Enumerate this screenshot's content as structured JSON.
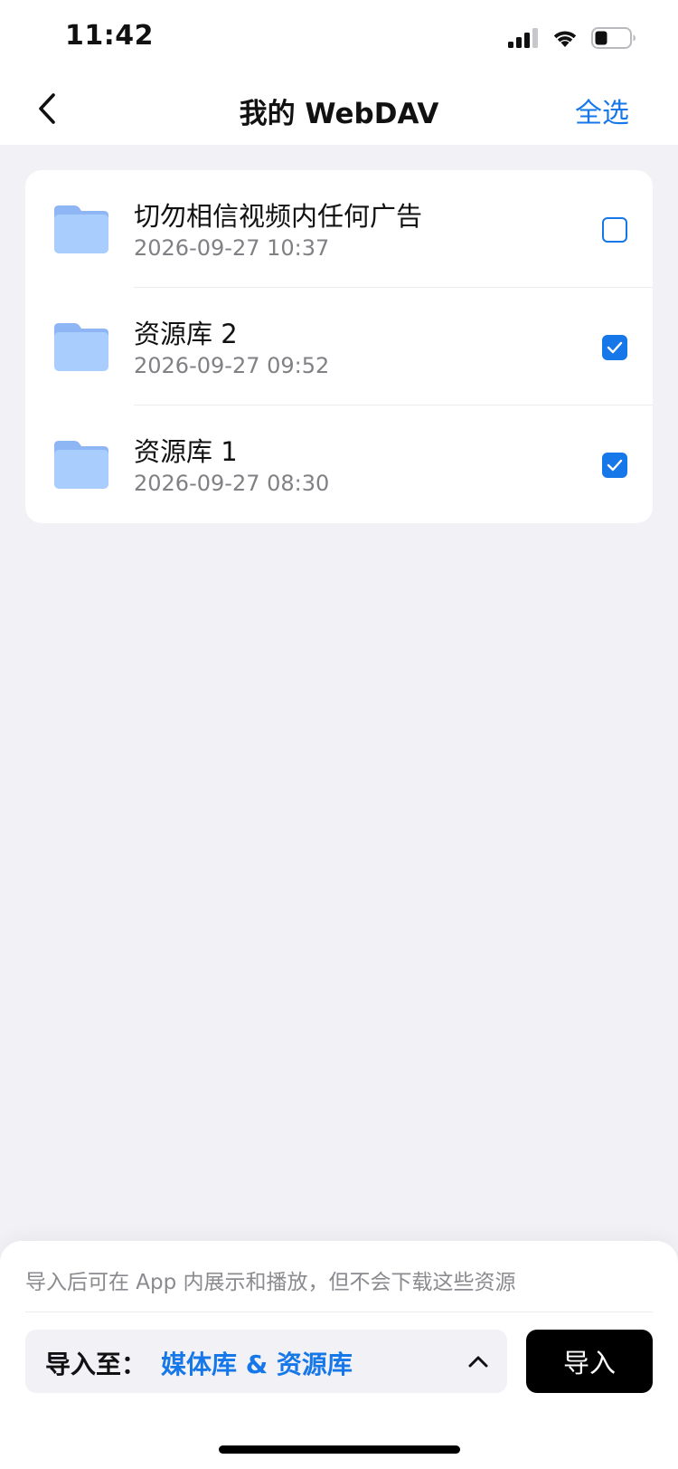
{
  "status_bar": {
    "time": "11:42"
  },
  "nav": {
    "title": "我的 WebDAV",
    "select_all_label": "全选"
  },
  "colors": {
    "accent": "#1677e8",
    "folder": "#9cc5fb",
    "background": "#f1f1f6"
  },
  "list": {
    "items": [
      {
        "name": "切勿相信视频内任何广告",
        "date": "2026-09-27 10:37",
        "checked": false
      },
      {
        "name": "资源库 2",
        "date": "2026-09-27 09:52",
        "checked": true
      },
      {
        "name": "资源库 1",
        "date": "2026-09-27 08:30",
        "checked": true
      }
    ]
  },
  "sheet": {
    "hint": "导入后可在 App 内展示和播放，但不会下载这些资源",
    "destination_label": "导入至：",
    "destination_value": "媒体库 & 资源库",
    "import_label": "导入"
  }
}
